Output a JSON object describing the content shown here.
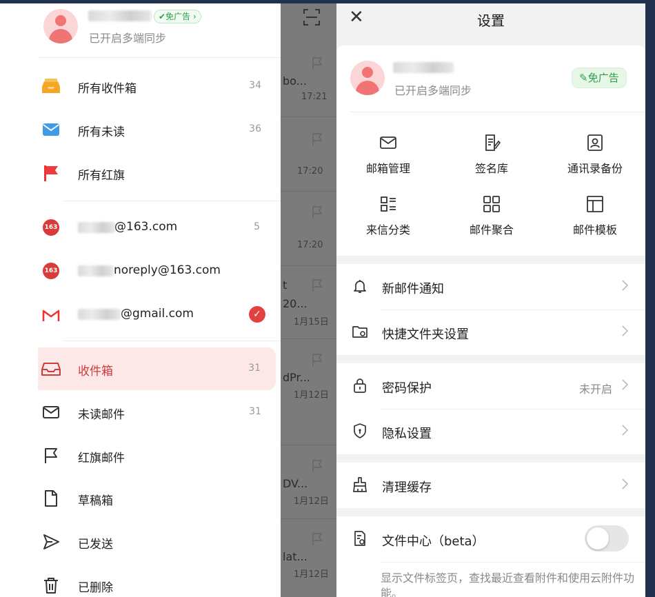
{
  "drawer": {
    "profile": {
      "ad_badge": "✔免广告 ›",
      "sync_status": "已开启多端同步"
    },
    "folders_top": [
      {
        "label": "所有收件箱",
        "count": "34",
        "icon": "inbox-stack-icon"
      },
      {
        "label": "所有未读",
        "count": "36",
        "icon": "envelope-icon"
      },
      {
        "label": "所有红旗",
        "count": "",
        "icon": "red-flag-icon"
      }
    ],
    "accounts": [
      {
        "suffix": "@163.com",
        "count": "5",
        "icon": "163-logo-icon"
      },
      {
        "suffix": "noreply@163.com",
        "count": "",
        "icon": "163-logo-icon"
      },
      {
        "suffix": "@gmail.com",
        "count": "",
        "icon": "gmail-logo-icon",
        "selected": true
      }
    ],
    "folders": [
      {
        "label": "收件箱",
        "count": "31",
        "active": true
      },
      {
        "label": "未读邮件",
        "count": "31"
      },
      {
        "label": "红旗邮件",
        "count": ""
      },
      {
        "label": "草稿箱",
        "count": ""
      },
      {
        "label": "已发送",
        "count": ""
      },
      {
        "label": "已删除",
        "count": ""
      }
    ],
    "colors": {
      "accent": "#e34040",
      "active_bg": "#fde8e8"
    }
  },
  "maillist": {
    "snippets": [
      {
        "text": "bo...",
        "time": "17:21"
      },
      {
        "text": "",
        "time": "17:20"
      },
      {
        "text": "",
        "time": "17:20"
      },
      {
        "text": "t",
        "text2": "20...",
        "time": "1月15日"
      },
      {
        "text": "dPr...",
        "time": "1月12日"
      },
      {
        "text": "DV...",
        "time": "1月12日"
      },
      {
        "text": "lat...",
        "time": "1月12日"
      }
    ]
  },
  "settings": {
    "title": "设置",
    "profile": {
      "sync_status": "已开启多端同步",
      "ad_badge": "免广告"
    },
    "grid": [
      {
        "label": "邮箱管理",
        "icon": "mail-manage-icon"
      },
      {
        "label": "签名库",
        "icon": "signature-icon"
      },
      {
        "label": "通讯录备份",
        "icon": "contacts-backup-icon"
      },
      {
        "label": "来信分类",
        "icon": "classify-icon"
      },
      {
        "label": "邮件聚合",
        "icon": "aggregate-icon"
      },
      {
        "label": "邮件模板",
        "icon": "template-icon"
      }
    ],
    "rows": {
      "notify": {
        "label": "新邮件通知"
      },
      "quick_folder": {
        "label": "快捷文件夹设置"
      },
      "password": {
        "label": "密码保护",
        "value": "未开启"
      },
      "privacy": {
        "label": "隐私设置"
      },
      "cache": {
        "label": "清理缓存"
      },
      "file_center": {
        "label": "文件中心（beta）",
        "enabled": false,
        "description": "显示文件标签页，查找最近查看附件和使用云附件功能。"
      }
    }
  }
}
